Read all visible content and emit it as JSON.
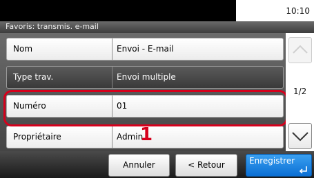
{
  "status": {
    "time": "10:10"
  },
  "title": "Favoris: transmis. e-mail",
  "rows": [
    {
      "label": "Nom",
      "value": "Envoi - E-mail"
    },
    {
      "label": "Type trav.",
      "value": "Envoi multiple"
    },
    {
      "label": "Numéro",
      "value": "01"
    },
    {
      "label": "Propriétaire",
      "value": "Admin"
    }
  ],
  "pager": {
    "indicator": "1/2"
  },
  "callout": "1",
  "buttons": {
    "cancel": "Annuler",
    "back": "< Retour",
    "save": "Enregistrer"
  },
  "colors": {
    "highlight": "#d6001c",
    "save_button": "#1a80e0"
  },
  "icons": {
    "scroll_up": "chevron-up-icon",
    "scroll_down": "chevron-down-icon",
    "save": "enter-icon"
  }
}
